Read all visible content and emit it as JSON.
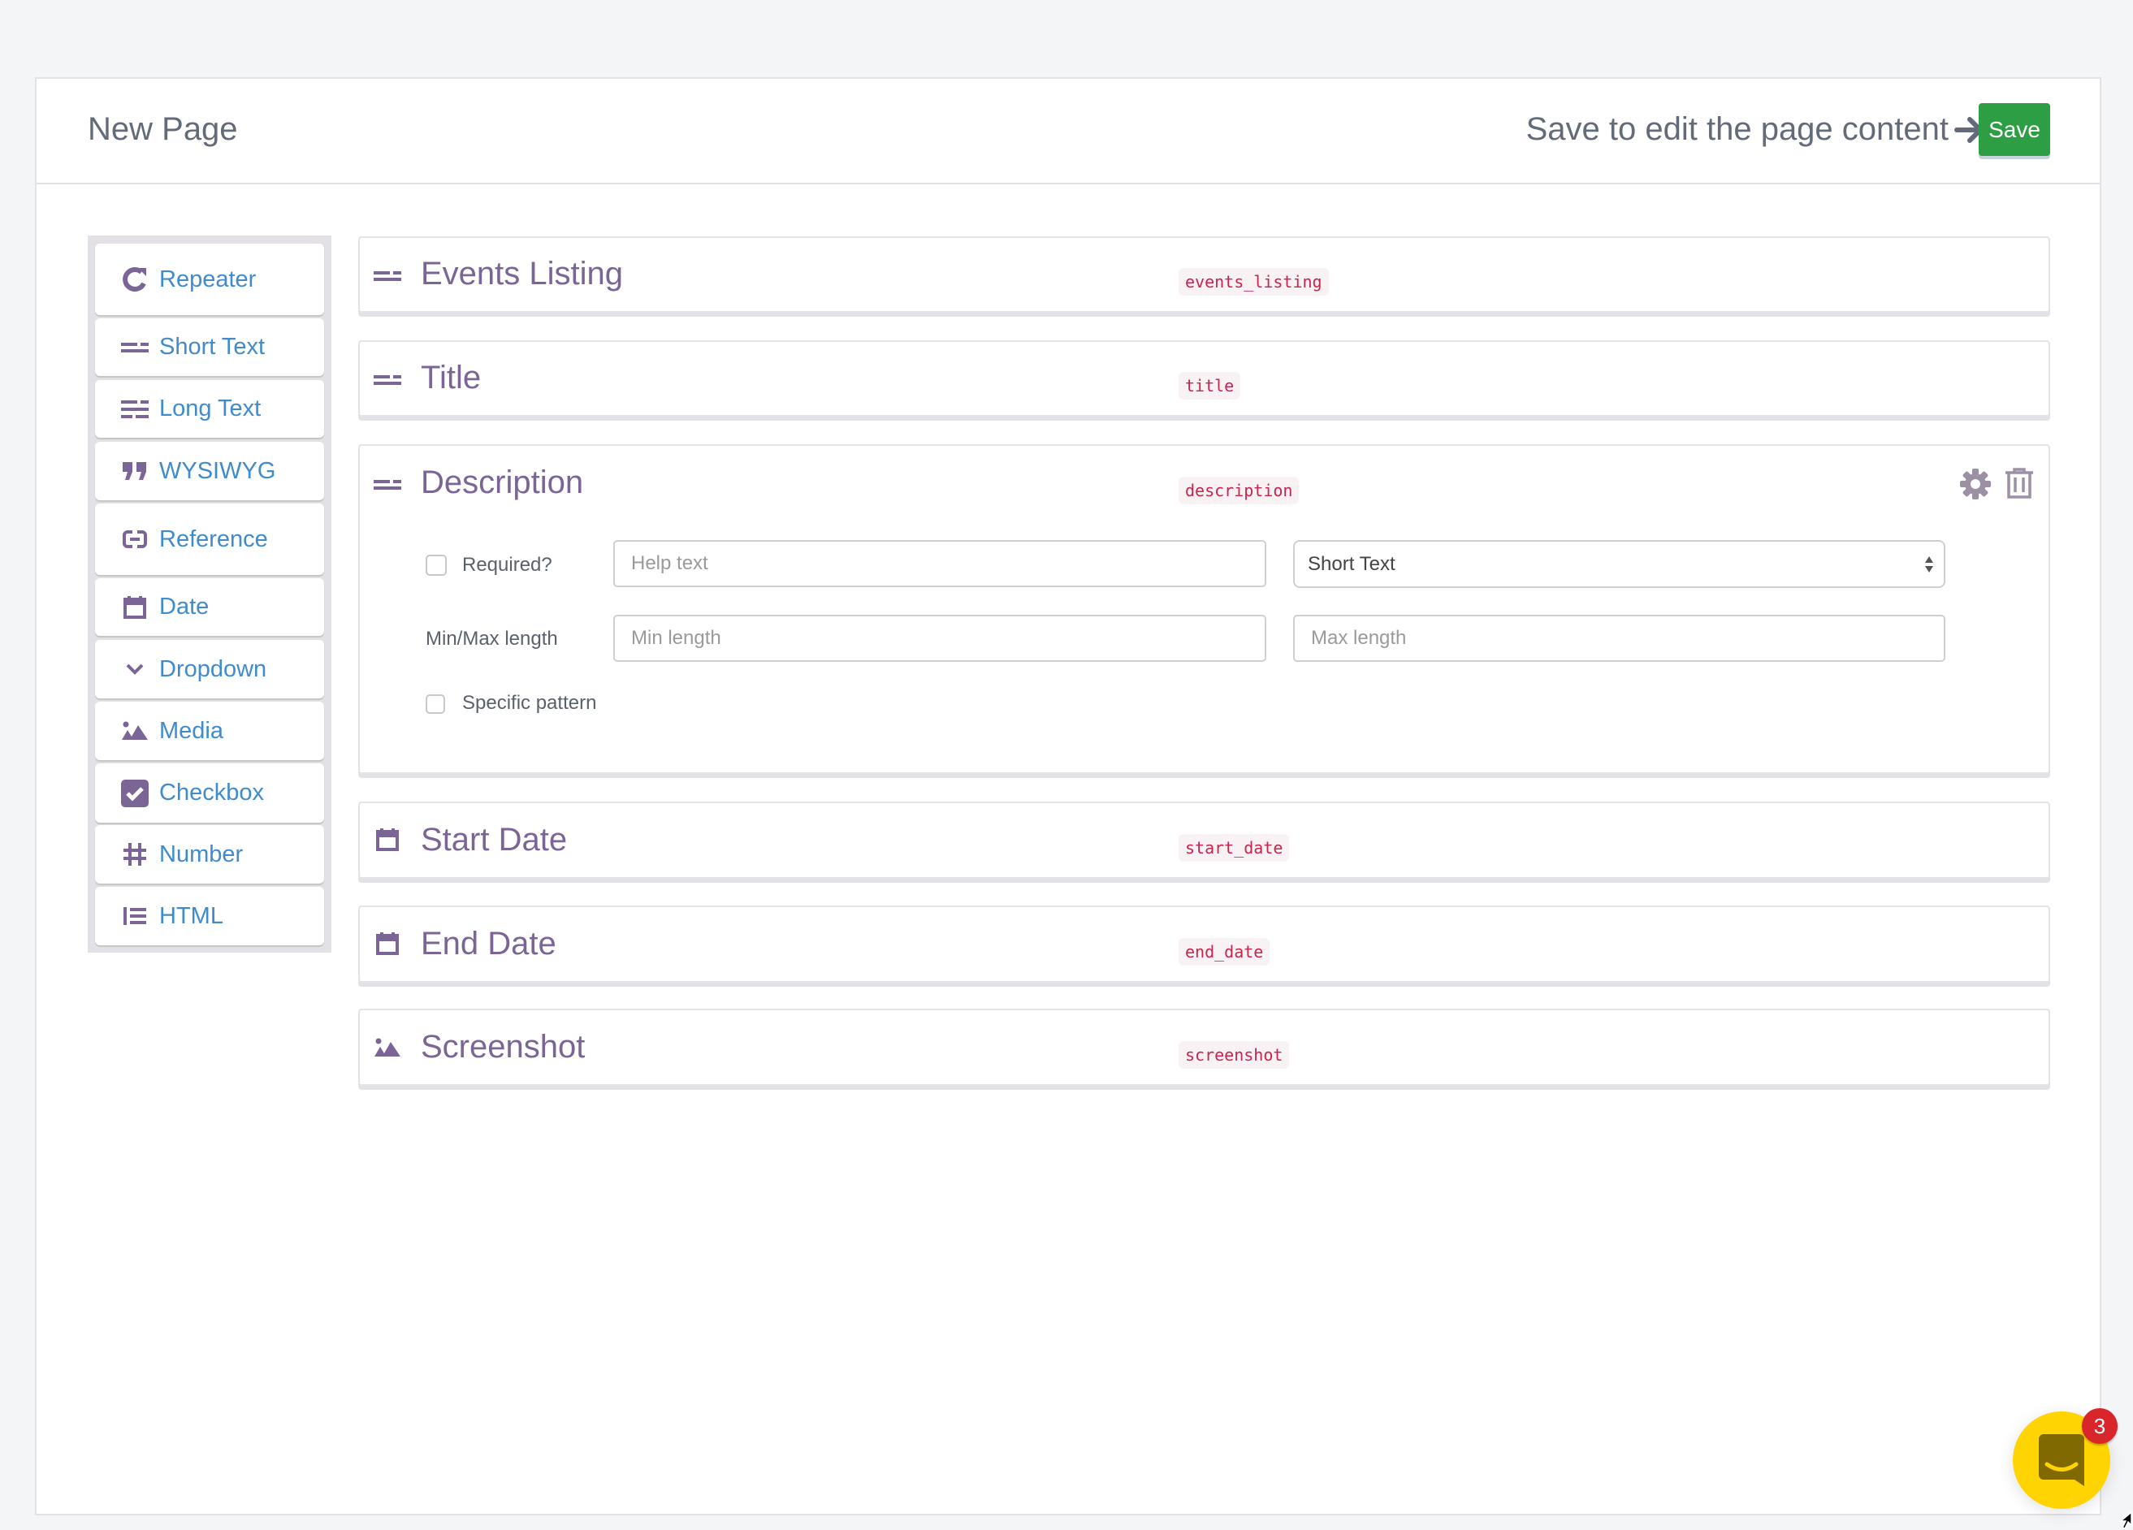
{
  "header": {
    "title": "New Page",
    "save_hint": "Save to edit the page content",
    "save_label": "Save"
  },
  "sidebar": {
    "items": [
      {
        "label": "Repeater",
        "icon": "repeat-icon"
      },
      {
        "label": "Short Text",
        "icon": "short-text-icon"
      },
      {
        "label": "Long Text",
        "icon": "long-text-icon"
      },
      {
        "label": "WYSIWYG",
        "icon": "quote-icon"
      },
      {
        "label": "Reference",
        "icon": "link-icon"
      },
      {
        "label": "Date",
        "icon": "calendar-icon"
      },
      {
        "label": "Dropdown",
        "icon": "chevron-down-icon"
      },
      {
        "label": "Media",
        "icon": "image-icon"
      },
      {
        "label": "Checkbox",
        "icon": "checkbox-icon"
      },
      {
        "label": "Number",
        "icon": "hash-icon"
      },
      {
        "label": "HTML",
        "icon": "list-icon"
      }
    ]
  },
  "fields": [
    {
      "title": "Events Listing",
      "key": "events_listing",
      "icon": "short-text-icon"
    },
    {
      "title": "Title",
      "key": "title",
      "icon": "short-text-icon"
    },
    {
      "title": "Description",
      "key": "description",
      "icon": "short-text-icon",
      "expanded": true
    },
    {
      "title": "Start Date",
      "key": "start_date",
      "icon": "calendar-icon"
    },
    {
      "title": "End Date",
      "key": "end_date",
      "icon": "calendar-icon"
    },
    {
      "title": "Screenshot",
      "key": "screenshot",
      "icon": "image-icon"
    }
  ],
  "description_options": {
    "required_label": "Required?",
    "required_checked": false,
    "help_placeholder": "Help text",
    "help_value": "",
    "type_selected": "Short Text",
    "minmax_label": "Min/Max length",
    "min_placeholder": "Min length",
    "max_placeholder": "Max length",
    "pattern_label": "Specific pattern",
    "pattern_checked": false
  },
  "chat": {
    "unread_count": "3"
  },
  "colors": {
    "accent_purple": "#7b6496",
    "link_blue": "#3f8bcd",
    "save_green": "#2e9e45",
    "key_red": "#c7254e",
    "chat_yellow": "#ffd400",
    "badge_red": "#d9262b"
  }
}
